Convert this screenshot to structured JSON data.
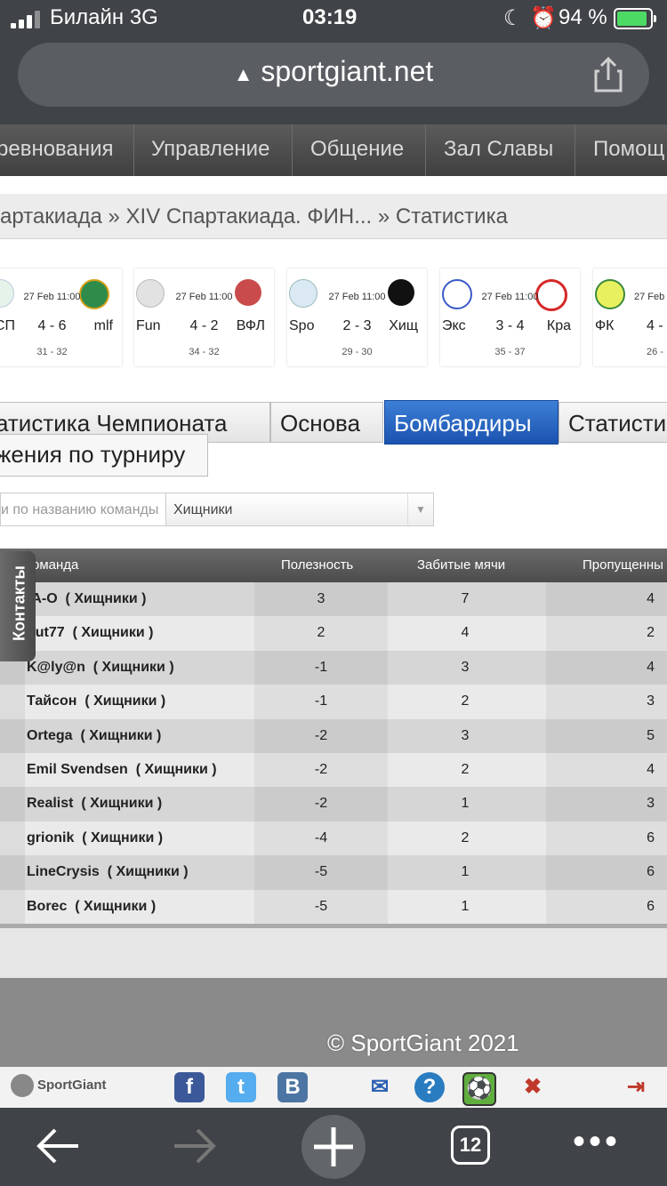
{
  "status_bar": {
    "carrier": "Билайн  3G",
    "time": "03:19",
    "battery": "94 %"
  },
  "browser": {
    "url": "sportgiant.net",
    "tab_count": "12"
  },
  "nav": {
    "items": [
      "ревнования",
      "Управление",
      "Общение",
      "Зал Славы",
      "Помощ"
    ]
  },
  "breadcrumb": {
    "text": "артакиада » XIV Спартакиада. ФИН... » Статистика"
  },
  "matches": [
    {
      "date": "27 Feb 11:00",
      "home": "СП",
      "score": "4 - 6",
      "away": "mlf",
      "sub": "31 - 32"
    },
    {
      "date": "27 Feb 11:00",
      "home": "Fun",
      "score": "4 - 2",
      "away": "ВФЛ",
      "sub": "34 - 32"
    },
    {
      "date": "27 Feb 11:00",
      "home": "Spo",
      "score": "2 - 3",
      "away": "Хищ",
      "sub": "29 - 30"
    },
    {
      "date": "27 Feb 11:00",
      "home": "Экс",
      "score": "3 - 4",
      "away": "Кра",
      "sub": "35 - 37"
    },
    {
      "date": "27 Feb",
      "home": "ФК",
      "score": "4 -",
      "away": "",
      "sub": "26 -"
    }
  ],
  "tabs": {
    "stats_champ": "атистика  Чемпионата",
    "main": "Основа",
    "scorers": "Бомбардиры",
    "stats": "Статисти",
    "standings": "жения по турниру"
  },
  "filter": {
    "placeholder": "и по названию команды",
    "selected": "Хищники"
  },
  "table": {
    "headers": {
      "team": "оманда",
      "usefulness": "Полезность",
      "goals": "Забитые мячи",
      "conceded": "Пропущенны"
    },
    "rows": [
      {
        "name": "-А-О",
        "team": "( Хищники )",
        "use": "3",
        "goals": "7",
        "conc": "4"
      },
      {
        "name": "hut77",
        "team": "( Хищники )",
        "use": "2",
        "goals": "4",
        "conc": "2"
      },
      {
        "name": "K@ly@n",
        "team": "( Хищники )",
        "use": "-1",
        "goals": "3",
        "conc": "4"
      },
      {
        "name": "Тайсон",
        "team": "( Хищники )",
        "use": "-1",
        "goals": "2",
        "conc": "3"
      },
      {
        "name": "Ortega",
        "team": "( Хищники )",
        "use": "-2",
        "goals": "3",
        "conc": "5"
      },
      {
        "name": "Emil Svendsen",
        "team": "( Хищники )",
        "use": "-2",
        "goals": "2",
        "conc": "4"
      },
      {
        "name": "Realist",
        "team": "( Хищники )",
        "use": "-2",
        "goals": "1",
        "conc": "3"
      },
      {
        "name": "grionik",
        "team": "( Хищники )",
        "use": "-4",
        "goals": "2",
        "conc": "6"
      },
      {
        "name": "LineCrysis",
        "team": "( Хищники )",
        "use": "-5",
        "goals": "1",
        "conc": "6"
      },
      {
        "name": "Borec",
        "team": "( Хищники )",
        "use": "-5",
        "goals": "1",
        "conc": "6"
      }
    ]
  },
  "side_tab": "Контакты",
  "footer": {
    "copyright": "© SportGiant 2021",
    "brand": "SportGiant"
  },
  "colors": {
    "active_tab": "#2a66c4",
    "nav_bg": "#4a4a4a",
    "browser_bg": "#404347"
  }
}
